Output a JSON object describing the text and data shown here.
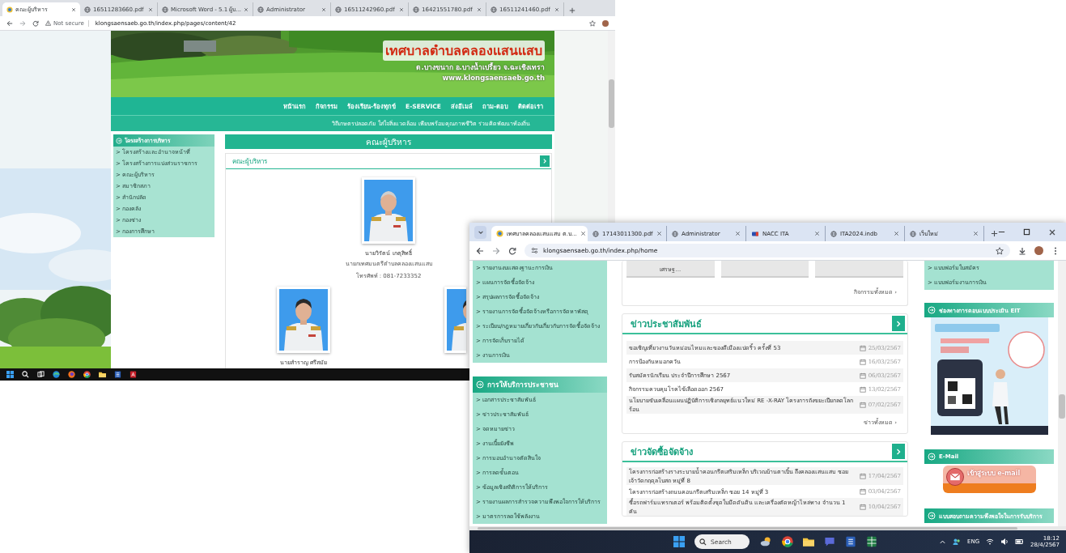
{
  "back_window": {
    "tabs": [
      {
        "title": "คณะผู้บริหาร",
        "selected": true
      },
      {
        "title": "16511283660.pdf",
        "selected": false
      },
      {
        "title": "Microsoft Word - 5.1 ผู้บ...",
        "selected": false
      },
      {
        "title": "Administrator",
        "selected": false
      },
      {
        "title": "16511242960.pdf",
        "selected": false
      },
      {
        "title": "16421551780.pdf",
        "selected": false
      },
      {
        "title": "16511241460.pdf",
        "selected": false
      }
    ],
    "address_bar": {
      "security": "Not secure",
      "url": "klongsaensaeb.go.th/index.php/pages/content/42"
    },
    "banner": {
      "title": "เทศบาลตำบลคลองแสนแสบ",
      "subtitle": "ต.บางขนาก อ.บางน้ำเปรี้ยว จ.ฉะเชิงเทรา",
      "website": "www.klongsaensaeb.go.th"
    },
    "nav": [
      "หน้าแรก",
      "กิจกรรม",
      "ร้องเรียน-ร้องทุกข์",
      "E-SERVICE",
      "ส่งอีเมล์",
      "ถาม-ตอบ",
      "ติดต่อเรา"
    ],
    "slogan": "วิถีเกษตรปลอดภัย ใส่ใจสิ่งแวดล้อม เพียบพร้อมคุณภาพชีวิต ร่วมคิดพัฒนาท้องถิ่น",
    "sidebar": {
      "title": "โครงสร้างการบริหาร",
      "items": [
        "> โครงสร้างและอำนาจหน้าที่",
        "> โครงสร้างการแบ่งส่วนราชการ",
        "> คณะผู้บริหาร",
        "> สมาชิกสภา",
        "> สำนักปลัด",
        "> กองคลัง",
        "> กองช่าง",
        "> กองการศึกษา"
      ]
    },
    "content": {
      "title": "คณะผู้บริหาร",
      "panel_title": "คณะผู้บริหาร",
      "executives": [
        {
          "name": "นายวิรัตน์ เกตุสิทธิ์",
          "role": "นายกเทศมนตรีตำบลคลองแสนแสบ",
          "phone": "โทรศัพท์ : 081-7233352"
        },
        {
          "name": "นายสำราญ ศรีสมัย"
        },
        {
          "kind": "picture"
        }
      ]
    }
  },
  "front_window": {
    "tabs": [
      {
        "title": "เทศบาลคลองแสนแสบ ต.บ...",
        "selected": true
      },
      {
        "title": "17143011300.pdf",
        "selected": false
      },
      {
        "title": "Administrator",
        "selected": false
      },
      {
        "title": "NACC ITA",
        "selected": false
      },
      {
        "title": "ITA2024.indb",
        "selected": false
      },
      {
        "title": "เว็บใหม่",
        "selected": false
      }
    ],
    "address_bar": {
      "url": "klongsaensaeb.go.th/index.php/home"
    },
    "sidebar_links": [
      "> รายงานงบแสดงฐานะการเงิน",
      "> แผนการจัดซื้อจัดจ้าง",
      "> สรุปผลการจัดซื้อจัดจ้าง",
      "> รายงานการจัดซื้อจัดจ้างหรือการจัดหาพัสดุ",
      "> ระเบียบ/กฎหมายเกี่ยวกับเกี่ยวกับการจัดซื้อจัดจ้าง",
      "> การจัดเก็บรายได้",
      "> งานการเงิน"
    ],
    "service_menu": {
      "title": "การให้บริการประชาชน",
      "items": [
        "> เอกสารประชาสัมพันธ์",
        "> ข่าวประชาสัมพันธ์",
        "> จดหมายข่าว",
        "> งานเบี้ยยังชีพ",
        "> การมอบอำนาจตัดสินใจ",
        "> การลดขั้นตอน",
        "> ข้อมูลเชิงสถิติการให้บริการ",
        "> รายงานผลการสำรวจความพึงพอใจการให้บริการ",
        "> มาตรการลดใช้พลังงาน"
      ]
    },
    "activities": {
      "cards": [
        {
          "kind": "card",
          "caption": "เศรษฐ..."
        },
        {
          "kind": "card"
        },
        {
          "kind": "card"
        }
      ],
      "more": "กิจกรรมทั้งหมด ›"
    },
    "news": {
      "title": "ข่าวประชาสัมพันธ์",
      "items": [
        {
          "text": "ขอเชิญเที่ยวงานวันหม่อนไหมและของดีเมืองแปดริ้ว ครั้งที่ 53",
          "date": "25/03/2567"
        },
        {
          "text": "การป้องกันหมอกควัน",
          "date": "16/03/2567"
        },
        {
          "text": "รับสมัครนักเรียน ประจำปีการศึกษา 2567",
          "date": "06/03/2567"
        },
        {
          "text": "กิจกรรมควบคุมโรคไข้เลือดออก 2567",
          "date": "13/02/2567"
        },
        {
          "text": "นโยบายขับเคลื่อนแผนปฏิบัติการเชิงกลยุทธ์แนวใหม่ RE -X-RAY โครงการถังขยะเปียกลดโลกร้อน",
          "date": "07/02/2567"
        }
      ],
      "more": "ข่าวทั้งหมด ›"
    },
    "procurement": {
      "title": "ข่าวจัดซื้อจัดจ้าง",
      "items": [
        {
          "text": "โครงการก่อสร้างรางระบายน้ำคอนกรีตเสริมเหล็ก บริเวณบ้านตาเบิ้น ถึงคลองแสนแสบ ซอยเจ้าวัดกฤดุลโบสถ หมู่ที่ 8",
          "date": "17/04/2567"
        },
        {
          "text": "โครงการก่อสร้างถนนคอนกรีตเสริมเหล็ก ซอย 14 หมู่ที่ 3",
          "date": "03/04/2567"
        },
        {
          "text": "ซื้อรถฟาร์มแทรกเตอร์ พร้อมติดตั้งชุดใบมีดดันดิน และเครื่องตัดหญ้าไหล่ทาง จำนวน 1 คัน",
          "date": "10/04/2567"
        }
      ]
    },
    "right_links": [
      "> แบบฟอร์มใบสมัคร",
      "> แบบฟอร์มงานการเงิน"
    ],
    "eit_title": "ช่องทางการตอบแบบประเมิน EIT",
    "email": {
      "title": "E-Mail",
      "button": "เข้าสู่ระบบ e-mail"
    },
    "survey_title": "แบบสอบถามความพึงพอใจในการรับบริการ",
    "taskbar": {
      "search": "Search",
      "language": "ENG",
      "time": "18:12",
      "date": "28/4/2567"
    }
  }
}
